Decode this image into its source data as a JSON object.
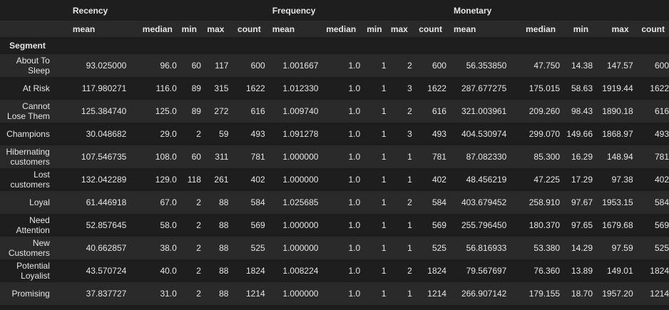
{
  "groups": [
    "Recency",
    "Frequency",
    "Monetary"
  ],
  "stats": [
    "mean",
    "median",
    "min",
    "max",
    "count"
  ],
  "index_name": "Segment",
  "rows": [
    {
      "segment": "About To\nSleep",
      "r": [
        "93.025000",
        "96.0",
        "60",
        "117",
        "600"
      ],
      "f": [
        "1.001667",
        "1.0",
        "1",
        "2",
        "600"
      ],
      "m": [
        "56.353850",
        "47.750",
        "14.38",
        "147.57",
        "600"
      ]
    },
    {
      "segment": "At Risk",
      "r": [
        "117.980271",
        "116.0",
        "89",
        "315",
        "1622"
      ],
      "f": [
        "1.012330",
        "1.0",
        "1",
        "3",
        "1622"
      ],
      "m": [
        "287.677275",
        "175.015",
        "58.63",
        "1919.44",
        "1622"
      ]
    },
    {
      "segment": "Cannot\nLose Them",
      "r": [
        "125.384740",
        "125.0",
        "89",
        "272",
        "616"
      ],
      "f": [
        "1.009740",
        "1.0",
        "1",
        "2",
        "616"
      ],
      "m": [
        "321.003961",
        "209.260",
        "98.43",
        "1890.18",
        "616"
      ]
    },
    {
      "segment": "Champions",
      "r": [
        "30.048682",
        "29.0",
        "2",
        "59",
        "493"
      ],
      "f": [
        "1.091278",
        "1.0",
        "1",
        "3",
        "493"
      ],
      "m": [
        "404.530974",
        "299.070",
        "149.66",
        "1868.97",
        "493"
      ]
    },
    {
      "segment": "Hibernating\ncustomers",
      "r": [
        "107.546735",
        "108.0",
        "60",
        "311",
        "781"
      ],
      "f": [
        "1.000000",
        "1.0",
        "1",
        "1",
        "781"
      ],
      "m": [
        "87.082330",
        "85.300",
        "16.29",
        "148.94",
        "781"
      ]
    },
    {
      "segment": "Lost\ncustomers",
      "r": [
        "132.042289",
        "129.0",
        "118",
        "261",
        "402"
      ],
      "f": [
        "1.000000",
        "1.0",
        "1",
        "1",
        "402"
      ],
      "m": [
        "48.456219",
        "47.225",
        "17.29",
        "97.38",
        "402"
      ]
    },
    {
      "segment": "Loyal",
      "r": [
        "61.446918",
        "67.0",
        "2",
        "88",
        "584"
      ],
      "f": [
        "1.025685",
        "1.0",
        "1",
        "2",
        "584"
      ],
      "m": [
        "403.679452",
        "258.910",
        "97.67",
        "1953.15",
        "584"
      ]
    },
    {
      "segment": "Need\nAttention",
      "r": [
        "52.857645",
        "58.0",
        "2",
        "88",
        "569"
      ],
      "f": [
        "1.000000",
        "1.0",
        "1",
        "1",
        "569"
      ],
      "m": [
        "255.796450",
        "180.370",
        "97.65",
        "1679.68",
        "569"
      ]
    },
    {
      "segment": "New\nCustomers",
      "r": [
        "40.662857",
        "38.0",
        "2",
        "88",
        "525"
      ],
      "f": [
        "1.000000",
        "1.0",
        "1",
        "1",
        "525"
      ],
      "m": [
        "56.816933",
        "53.380",
        "14.29",
        "97.59",
        "525"
      ]
    },
    {
      "segment": "Potential\nLoyalist",
      "r": [
        "43.570724",
        "40.0",
        "2",
        "88",
        "1824"
      ],
      "f": [
        "1.008224",
        "1.0",
        "1",
        "2",
        "1824"
      ],
      "m": [
        "79.567697",
        "76.360",
        "13.89",
        "149.01",
        "1824"
      ]
    },
    {
      "segment": "Promising",
      "r": [
        "37.837727",
        "31.0",
        "2",
        "88",
        "1214"
      ],
      "f": [
        "1.000000",
        "1.0",
        "1",
        "1",
        "1214"
      ],
      "m": [
        "266.907142",
        "179.155",
        "18.70",
        "1957.20",
        "1214"
      ]
    }
  ]
}
